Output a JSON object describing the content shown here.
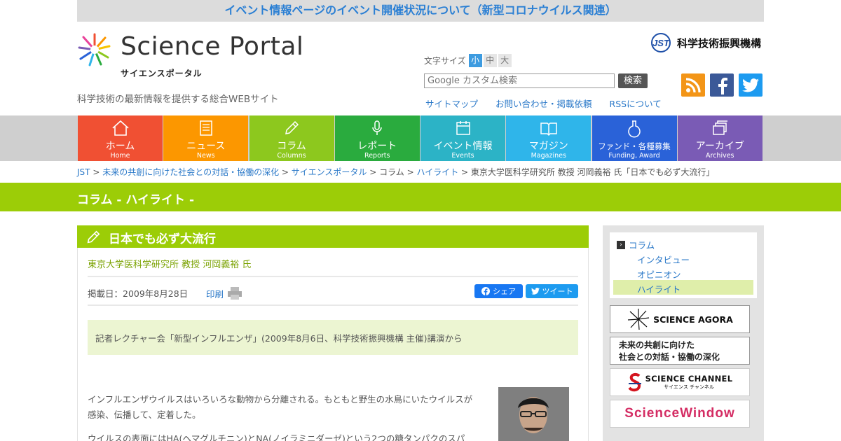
{
  "notice": "イベント情報ページのイベント開催状況について（新型コロナウイルス関連）",
  "logo": {
    "name": "Science Portal",
    "kana": "サイエンスポータル"
  },
  "tagline": "科学技術の最新情報を提供する総合WEBサイト",
  "font_size": {
    "label": "文字サイズ",
    "options": [
      "小",
      "中",
      "大"
    ],
    "selected": "小"
  },
  "search": {
    "placeholder": "Google カスタム検索",
    "button": "検索"
  },
  "top_links": [
    "サイトマップ",
    "お問い合わせ・掲載依頼",
    "RSSについて"
  ],
  "jst": {
    "mark": "JST",
    "name": "科学技術振興機構"
  },
  "social": [
    "rss-icon",
    "facebook-icon",
    "twitter-icon"
  ],
  "nav": [
    {
      "ja": "ホーム",
      "en": "Home",
      "color": "#f05033",
      "icon": "home-icon"
    },
    {
      "ja": "ニュース",
      "en": "News",
      "color": "#fc9700",
      "icon": "news-icon"
    },
    {
      "ja": "コラム",
      "en": "Columns",
      "color": "#8dc81e",
      "icon": "pencil-icon"
    },
    {
      "ja": "レポート",
      "en": "Reports",
      "color": "#2aab3e",
      "icon": "microphone-icon"
    },
    {
      "ja": "イベント情報",
      "en": "Events",
      "color": "#2cb3c6",
      "icon": "calendar-icon"
    },
    {
      "ja": "マガジン",
      "en": "Magazines",
      "color": "#2fb5ea",
      "icon": "book-icon"
    },
    {
      "ja": "ファンド・各種募集",
      "en": "Funding, Award",
      "color": "#2a62d8",
      "icon": "flask-icon"
    },
    {
      "ja": "アーカイブ",
      "en": "Archives",
      "color": "#7a5bb5",
      "icon": "archive-icon"
    }
  ],
  "breadcrumb": {
    "links": [
      "JST",
      "未来の共創に向けた社会との対話・協働の深化",
      "サイエンスポータル"
    ],
    "plain": [
      "コラム"
    ],
    "link2": "ハイライト",
    "current": "東京大学医科学研究所 教授 河岡義裕 氏「日本でも必ず大流行」"
  },
  "section_title": "コラム - ハイライト -",
  "article": {
    "title": "日本でも必ず大流行",
    "author": "東京大学医科学研究所 教授 河岡義裕 氏",
    "date": "掲載日：2009年8月28日",
    "print": "印刷",
    "share": "シェア",
    "tweet": "ツイート",
    "lead": "記者レクチャー会「新型インフルエンザ」(2009年8月6日、科学技術振興機構 主催)講演から",
    "body1": "インフルエンザウイルスはいろいろな動物から分離される。もともと野生の水鳥にいたウイルスが感染、伝播して、定着した。",
    "body2": "ウイルスの表面にはHA(ヘマグルチニン)とNA(ノイラミニダーゼ)という2つの糖タンパクのスパ"
  },
  "sidebar": {
    "root": "コラム",
    "items": [
      "インタビュー",
      "オピニオン",
      "ハイライト"
    ],
    "selected": "ハイライト"
  },
  "banners": {
    "agora": "SCIENCE AGORA",
    "kyoso_line1": "未来の共創に向けた",
    "kyoso_line2": "社会との対話・協働の深化",
    "channel": "SCIENCE CHANNEL",
    "channel_kana": "サイエンス チャンネル",
    "window": "ScienceWindow"
  }
}
